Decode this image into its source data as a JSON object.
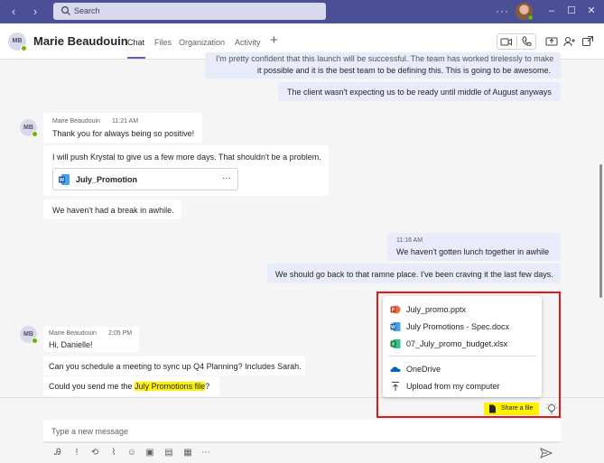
{
  "titlebar": {
    "back_icon": "‹",
    "forward_icon": "›",
    "search_placeholder": "Search",
    "more": "···",
    "window_min": "–",
    "window_max": "☐",
    "window_close": "✕"
  },
  "header": {
    "avatar_initials": "MB",
    "contact_name": "Marie Beaudouin",
    "tabs": [
      {
        "label": "Chat"
      },
      {
        "label": "Files"
      },
      {
        "label": "Organization"
      },
      {
        "label": "Activity"
      }
    ],
    "add_tab": "+"
  },
  "messages": {
    "mine_top_line1": "I'm pretty confident that this launch will be successful. The team has worked tirelessly to make",
    "mine_top_line2": "it possible and it is the best team to be defining this. This is going to be awesome.",
    "mine_top_2": "The client wasn't expecting us to be ready until middle of August anyways",
    "group1": {
      "avatar": "MB",
      "sender": "Marie Beaudouin",
      "time": "11:21 AM",
      "msg1": "Thank you for always being so positive!",
      "msg2": "I will push Krystal to give us a few more days. That shouldn't be a problem.",
      "file_name": "July_Promotion",
      "file_more": "···",
      "msg3": "We haven't had a break in awhile."
    },
    "mine_group": {
      "time": "11:16 AM",
      "msg1": "We haven't gotten lunch together in awhile",
      "msg2": "We should go back to that ramne place. I've been craving it the last few days."
    },
    "group2": {
      "avatar": "MB",
      "sender": "Marie Beaudouin",
      "time": "2:05 PM",
      "msg1": "Hi, Danielle!",
      "msg2": "Can you schedule a meeting to sync up Q4 Planning? Includes Sarah.",
      "msg3_prefix": "Could you send me the ",
      "msg3_highlight": "July Promotions file",
      "msg3_suffix": "?"
    }
  },
  "share_menu": {
    "items": [
      {
        "label": "July_promo.pptx",
        "icon": "powerpoint-icon",
        "color": "#c43e1c"
      },
      {
        "label": "July Promotions - Spec.docx",
        "icon": "word-icon",
        "color": "#185abd"
      },
      {
        "label": "07_July_promo_budget.xlsx",
        "icon": "excel-icon",
        "color": "#107c41"
      },
      {
        "label": "OneDrive",
        "icon": "onedrive-icon",
        "color": "#0364b8"
      },
      {
        "label": "Upload from my computer",
        "icon": "upload-icon",
        "color": "#424242"
      }
    ],
    "share_button": "Share a file"
  },
  "compose": {
    "placeholder": "Type a new message"
  },
  "colors": {
    "titlebar": "#4b4f96",
    "accent": "#5b5fc7",
    "highlight": "#fff100",
    "callout_border": "#e3171a",
    "presence": "#6bb700"
  }
}
